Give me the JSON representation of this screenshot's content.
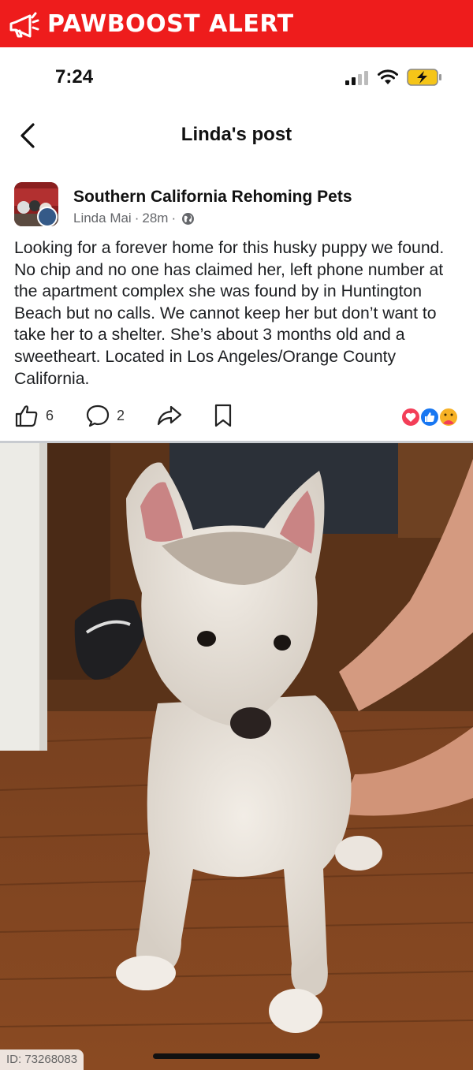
{
  "alert": {
    "label": "PAWBOOST ALERT",
    "icon": "megaphone-icon",
    "color": "#ee1c1c"
  },
  "status": {
    "time": "7:24",
    "icons": [
      "cellular-signal-icon",
      "wifi-icon",
      "battery-charging-icon"
    ]
  },
  "nav": {
    "title": "Linda's post",
    "back_icon": "chevron-left-icon"
  },
  "post": {
    "group_name": "Southern California Rehoming Pets",
    "author": "Linda Mai",
    "time_ago": "28m",
    "separator": "·",
    "audience_icon": "globe-icon",
    "text": "Looking for a forever home for this husky puppy we found. No chip and no one has claimed her, left phone number at the apartment complex she was found by in Huntington Beach but no calls. We cannot keep her but don’t want to take her to a shelter. She’s about 3 months old and a sweetheart. Located in Los Angeles/Orange County California.",
    "likes": "6",
    "comments": "2",
    "reactions": [
      "love-icon",
      "like-icon",
      "care-icon"
    ]
  },
  "photo": {
    "subject": "husky puppy on wood floor"
  },
  "footer": {
    "id": "ID: 73268083"
  }
}
